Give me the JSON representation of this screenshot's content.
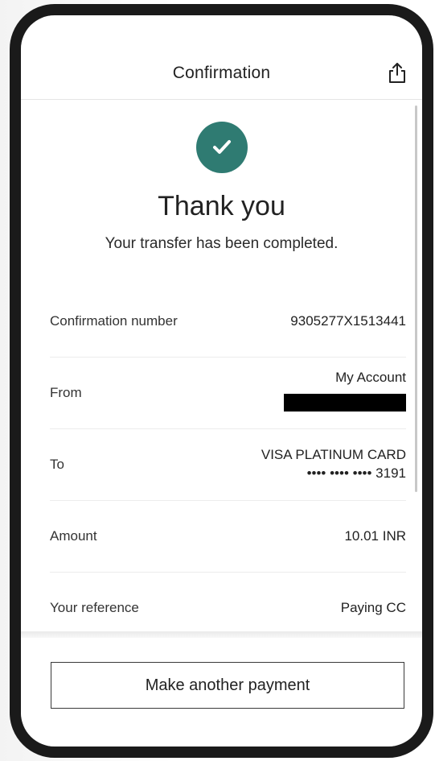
{
  "header": {
    "title": "Confirmation",
    "share_icon": "share-icon"
  },
  "status": {
    "icon": "check-icon",
    "accent_color": "#2f7b72",
    "title": "Thank you",
    "message": "Your transfer has been completed."
  },
  "details": {
    "confirmation_number": {
      "label": "Confirmation number",
      "value": "9305277X1513441"
    },
    "from": {
      "label": "From",
      "value": "My Account"
    },
    "to": {
      "label": "To",
      "value": "VISA PLATINUM CARD",
      "masked_number": "•••• •••• •••• 3191"
    },
    "amount": {
      "label": "Amount",
      "value": "10.01 INR"
    },
    "reference": {
      "label": "Your reference",
      "value": "Paying CC"
    }
  },
  "actions": {
    "make_another_payment": "Make another payment"
  }
}
